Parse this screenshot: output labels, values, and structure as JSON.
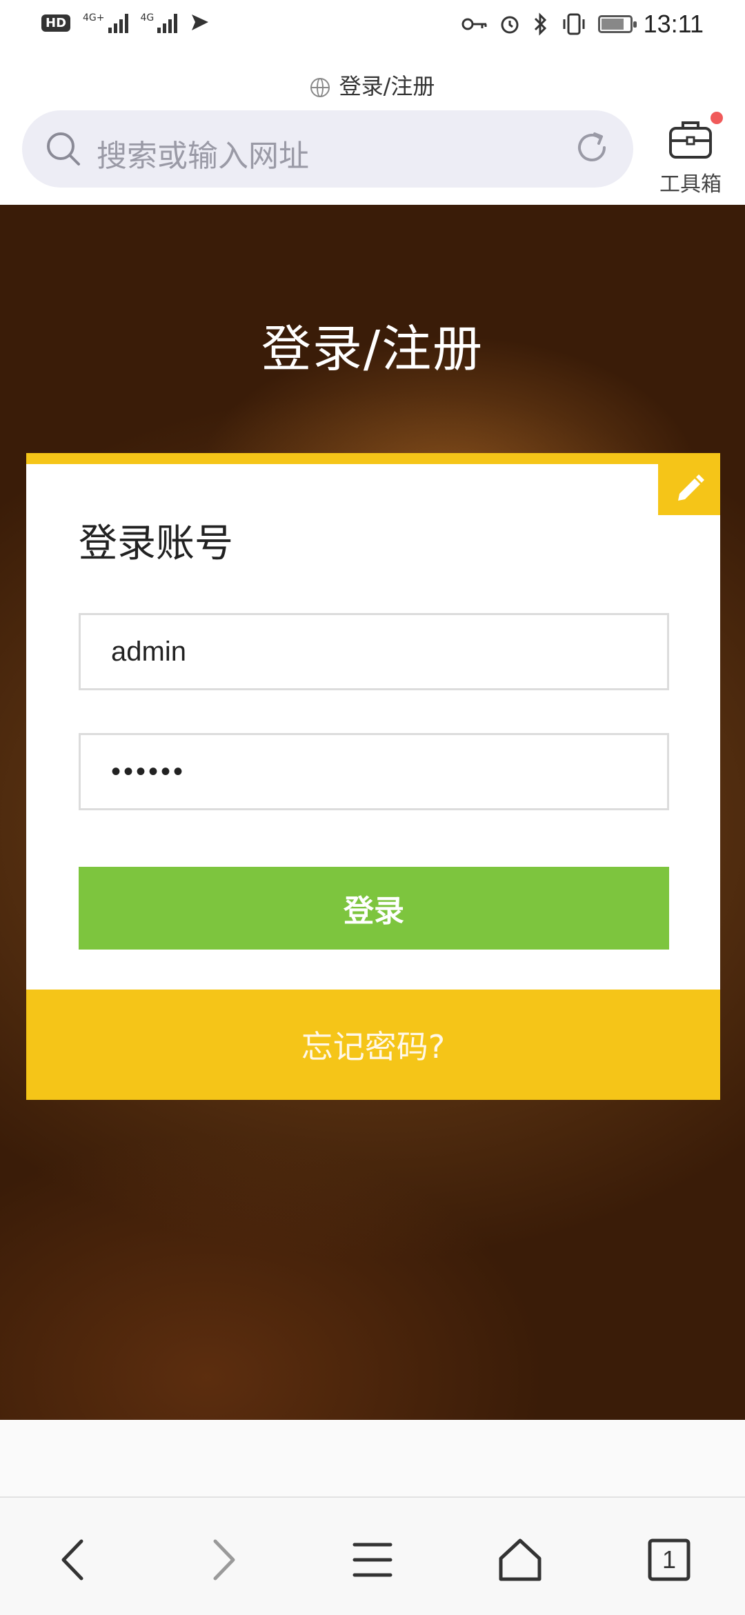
{
  "status_bar": {
    "hd_badge": "HD",
    "sim1_label": "4G+",
    "sim2_label": "4G",
    "time": "13:11"
  },
  "browser": {
    "page_title": "登录/注册",
    "search_placeholder": "搜索或输入网址",
    "toolbox_label": "工具箱",
    "tabs_count": "1"
  },
  "page": {
    "title": "登录/注册",
    "card_heading": "登录账号",
    "username_value": "admin",
    "password_value": "••••••",
    "login_button": "登录",
    "forgot_link": "忘记密码?"
  },
  "colors": {
    "accent_yellow": "#f5c518",
    "login_green": "#7dc53e",
    "background_brown": "#5a3210"
  },
  "icons": [
    "globe-icon",
    "search-icon",
    "reload-icon",
    "toolbox-icon",
    "pencil-icon",
    "back-icon",
    "forward-icon",
    "menu-icon",
    "home-icon",
    "tabs-icon"
  ]
}
